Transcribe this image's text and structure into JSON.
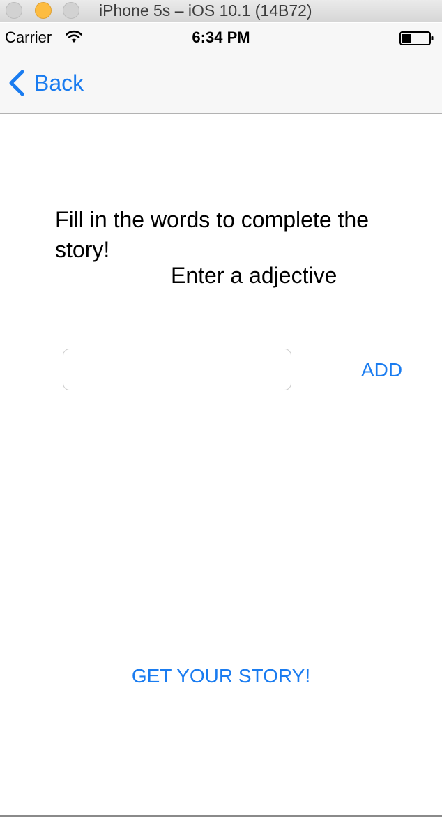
{
  "window": {
    "title": "iPhone 5s – iOS 10.1 (14B72)",
    "controls": [
      "close-icon",
      "minimize-icon",
      "zoom-icon"
    ]
  },
  "status_bar": {
    "carrier": "Carrier",
    "time": "6:34 PM",
    "icons": [
      "wifi-icon",
      "battery-icon"
    ]
  },
  "nav": {
    "back_label": "Back",
    "back_icon": "chevron-left-icon"
  },
  "content": {
    "instructions": "Fill in the words to complete the story!",
    "prompt": "Enter a adjective",
    "input_value": "",
    "input_placeholder": "",
    "add_label": "ADD",
    "story_label": "GET YOUR STORY!"
  },
  "colors": {
    "accent": "#1a7cf0",
    "nav_background": "#f7f7f7",
    "minimize_button": "#fdbc40"
  }
}
